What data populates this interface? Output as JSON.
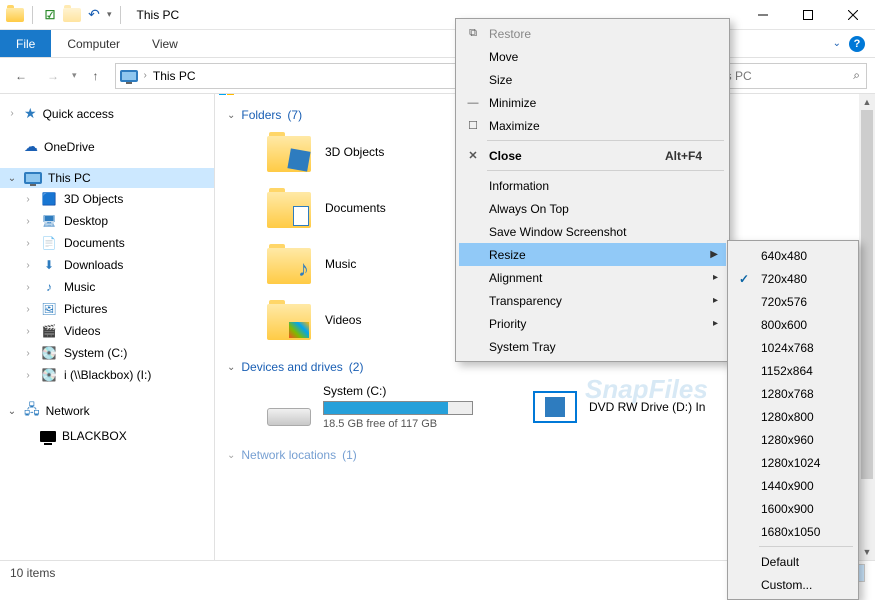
{
  "title": "This PC",
  "ribbon": {
    "file": "File",
    "computer": "Computer",
    "view": "View"
  },
  "address": {
    "location": "This PC",
    "search_placeholder": "This PC"
  },
  "tree": {
    "quick_access": "Quick access",
    "onedrive": "OneDrive",
    "this_pc": "This PC",
    "items": [
      "3D Objects",
      "Desktop",
      "Documents",
      "Downloads",
      "Music",
      "Pictures",
      "Videos",
      "System (C:)",
      "i (\\\\Blackbox) (I:)"
    ],
    "network": "Network",
    "blackbox": "BLACKBOX"
  },
  "groups": {
    "folders": {
      "label": "Folders",
      "count": "(7)"
    },
    "drives": {
      "label": "Devices and drives",
      "count": "(2)"
    },
    "netloc": {
      "label": "Network locations",
      "count": "(1)"
    }
  },
  "folders": [
    "3D Objects",
    "Documents",
    "Music",
    "Videos"
  ],
  "drives": {
    "system": {
      "name": "System (C:)",
      "free": "18.5 GB free of 117 GB",
      "fill_pct": 84
    },
    "dvd": {
      "name": "DVD RW Drive (D:) In"
    }
  },
  "status": {
    "items": "10 items"
  },
  "ctx": {
    "restore": "Restore",
    "move": "Move",
    "size": "Size",
    "minimize": "Minimize",
    "maximize": "Maximize",
    "close": "Close",
    "close_shortcut": "Alt+F4",
    "information": "Information",
    "always_on_top": "Always On Top",
    "save_screenshot": "Save Window Screenshot",
    "resize": "Resize",
    "alignment": "Alignment",
    "transparency": "Transparency",
    "priority": "Priority",
    "system_tray": "System Tray"
  },
  "resize_options": [
    "640x480",
    "720x480",
    "720x576",
    "800x600",
    "1024x768",
    "1152x864",
    "1280x768",
    "1280x800",
    "1280x960",
    "1280x1024",
    "1440x900",
    "1600x900",
    "1680x1050"
  ],
  "resize_extra": {
    "default": "Default",
    "custom": "Custom..."
  },
  "resize_selected": "720x480",
  "watermark": "SnapFiles"
}
